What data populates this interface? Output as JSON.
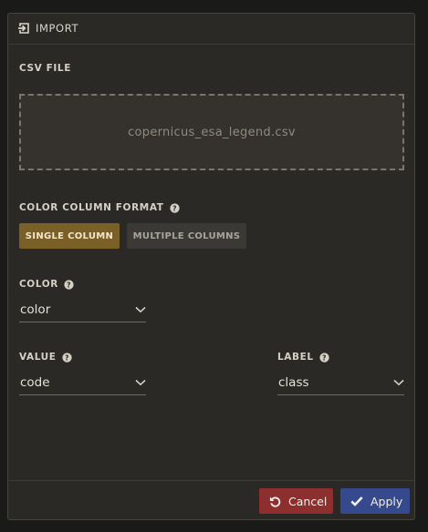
{
  "header": {
    "title": "IMPORT",
    "icon": "import-icon"
  },
  "csv": {
    "label": "CSV FILE",
    "filename": "copernicus_esa_legend.csv"
  },
  "color_format": {
    "label": "COLOR COLUMN FORMAT",
    "options": [
      "SINGLE COLUMN",
      "MULTIPLE COLUMNS"
    ],
    "selected": "SINGLE COLUMN"
  },
  "color": {
    "label": "COLOR",
    "value": "color"
  },
  "value": {
    "label": "VALUE",
    "value": "code"
  },
  "label_field": {
    "label": "LABEL",
    "value": "class"
  },
  "footer": {
    "cancel_label": "Cancel",
    "apply_label": "Apply"
  },
  "colors": {
    "accent": "#7a5f26",
    "cancel": "#8e2f2f",
    "apply": "#35498c",
    "panel": "#2a2925"
  }
}
